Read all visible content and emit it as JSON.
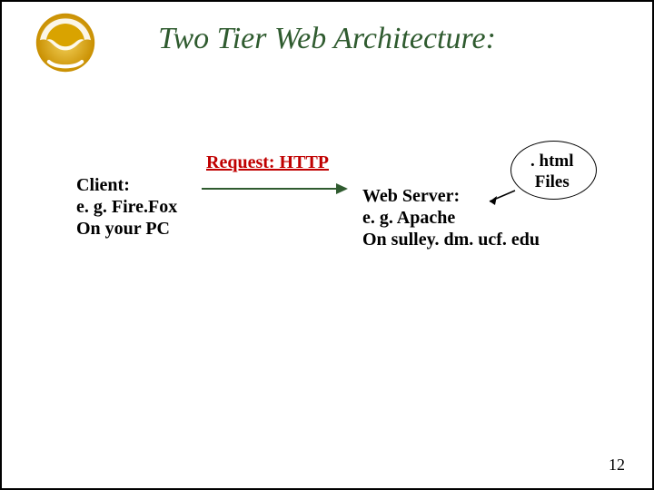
{
  "title": "Two Tier Web Architecture:",
  "request_label": "Request: HTTP",
  "client": "Client:\ne. g. Fire.Fox\nOn your PC",
  "server": "Web Server:\ne. g. Apache\nOn sulley. dm. ucf. edu",
  "files": ". html\nFiles",
  "page_number": "12",
  "logo_color": "#d9a300"
}
